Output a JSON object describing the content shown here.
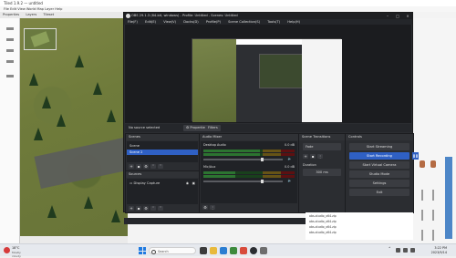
{
  "background_app": {
    "title": "Tiled 1.9.2 — untitled",
    "menu": "File  Edit  View  World  Map  Layer  Help",
    "tabs": [
      "Properties",
      "Layers",
      "Tileset",
      "Objects"
    ]
  },
  "obs": {
    "title": "OBS 29.1.3 (64-bit, windows) - Profile: Untitled - Scenes: Untitled",
    "menu": [
      "File(F)",
      "Edit(E)",
      "View(V)",
      "Docks(D)",
      "Profile(P)",
      "Scene Collection(S)",
      "Tools(T)",
      "Help(H)"
    ],
    "source_bar": {
      "label": "No source selected",
      "properties_btn": "⚙ Properties",
      "filters_btn": "Filters"
    },
    "scenes": {
      "header": "Scenes",
      "items": [
        "Scene",
        "Scene 2"
      ]
    },
    "sources": {
      "header": "Sources",
      "items": [
        "Display Capture"
      ]
    },
    "mixer": {
      "header": "Audio Mixer",
      "channels": [
        {
          "name": "Desktop Audio",
          "db": "0.0 dB",
          "level": 0.62,
          "volume": 0.72
        },
        {
          "name": "Mic/Aux",
          "db": "0.0 dB",
          "level": 0.35,
          "volume": 0.72
        }
      ]
    },
    "transitions": {
      "header": "Scene Transitions",
      "type": "Fade",
      "duration_label": "Duration",
      "duration": "300 ms"
    },
    "controls": {
      "header": "Controls",
      "buttons": [
        "Start Streaming",
        "Start Recording",
        "Start Virtual Camera",
        "Studio Mode",
        "Settings",
        "Exit"
      ]
    },
    "status": "LIVE: 00:00:00   REC: 00:00:00   CPU: 0.9%, 30.00 / 30.00 FPS"
  },
  "files": [
    "obs-studio_x64.zip",
    "obs-studio_x64.zip",
    "obs-studio_x64.zip",
    "obs-studio_x64.zip"
  ],
  "taskbar": {
    "weather_temp": "18°C",
    "weather_desc": "Mostly cloudy",
    "search_placeholder": "Search",
    "time": "3:22 PM",
    "date": "2023/9/14"
  },
  "colors": {
    "accent": "#2f60c4",
    "obs_bg": "#2b2d31"
  }
}
